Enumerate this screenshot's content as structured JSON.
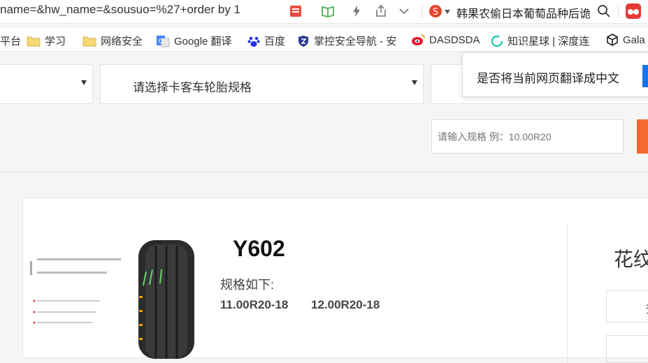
{
  "browser": {
    "url_fragment": "name=&hw_name=&sousuo=%27+order by 1",
    "search_engine_text": "韩果农偷日本葡萄品种后诡"
  },
  "bookmarks": [
    {
      "label": "平台",
      "icon": "none"
    },
    {
      "label": "学习",
      "icon": "folder-icon"
    },
    {
      "label": "网络安全",
      "icon": "folder-icon"
    },
    {
      "label": "Google 翻译",
      "icon": "google-translate-icon"
    },
    {
      "label": "百度",
      "icon": "baidu-icon"
    },
    {
      "label": "掌控安全导航 - 安",
      "icon": "shield-icon"
    },
    {
      "label": "DASDSDA",
      "icon": "weibo-icon"
    },
    {
      "label": "知识星球 | 深度连",
      "icon": "planet-icon"
    },
    {
      "label": "Gala",
      "icon": "cube-icon"
    }
  ],
  "filters": {
    "select1_label": "",
    "select2_label": "请选择卡客车轮胎规格",
    "spec_placeholder": "请输入规格 例：10.00R20"
  },
  "translate_prompt": {
    "message": "是否将当前网页翻译成中文"
  },
  "product": {
    "model": "Y602",
    "spec_heading": "规格如下:",
    "specs": [
      "11.00R20-18",
      "12.00R20-18"
    ],
    "side_title": "花纹",
    "side_box_char": "查"
  },
  "colors": {
    "accent_orange": "#f26a2e",
    "accent_blue": "#1a73e8"
  }
}
